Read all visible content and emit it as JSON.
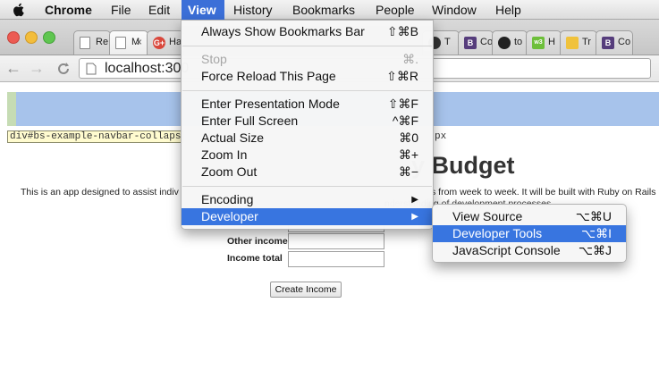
{
  "menubar": {
    "app_name": "Chrome",
    "items": [
      "File",
      "Edit",
      "View",
      "History",
      "Bookmarks",
      "People",
      "Window",
      "Help"
    ]
  },
  "tabs": [
    {
      "favicon": "document-icon",
      "title": "Re"
    },
    {
      "favicon": "document-icon",
      "title": "M",
      "close": "×"
    },
    {
      "favicon": "google-plus-icon",
      "favicon_text": "G+",
      "title": "Ha"
    },
    {
      "favicon": "github-icon",
      "title": "T"
    },
    {
      "favicon": "bootstrap-icon",
      "favicon_text": "B",
      "title": "Co"
    },
    {
      "favicon": "github-icon",
      "title": "to"
    },
    {
      "favicon": "w3c-icon",
      "favicon_text": "w3",
      "title": "H"
    },
    {
      "favicon": "bird-icon",
      "title": "Tr"
    },
    {
      "favicon": "bootstrap-icon",
      "favicon_text": "B",
      "title": "Co"
    }
  ],
  "toolbar": {
    "back": "←",
    "forward": "→",
    "url": "localhost:300"
  },
  "page": {
    "inspector_tooltip": "div#bs-example-navbar-collaps",
    "inspector_suffix": "px",
    "heading": "y Budget",
    "intro": "This is an app designed to assist indiv",
    "intro_right": "s from week to week. It will be built with Ruby on Rails",
    "intro2": "nderstanding of development processes",
    "labels": {
      "other_income": "Other income",
      "income_total": "Income total"
    },
    "submit": "Create Income"
  },
  "view_menu": {
    "items": [
      {
        "label": "Always Show Bookmarks Bar",
        "shortcut": "⇧⌘B"
      },
      {
        "label": "Stop",
        "shortcut": "⌘.",
        "disabled": true
      },
      {
        "label": "Force Reload This Page",
        "shortcut": "⇧⌘R"
      },
      {
        "label": "Enter Presentation Mode",
        "shortcut": "⇧⌘F"
      },
      {
        "label": "Enter Full Screen",
        "shortcut": "^⌘F"
      },
      {
        "label": "Actual Size",
        "shortcut": "⌘0"
      },
      {
        "label": "Zoom In",
        "shortcut": "⌘+"
      },
      {
        "label": "Zoom Out",
        "shortcut": "⌘−"
      },
      {
        "label": "Encoding",
        "shortcut": "▶"
      },
      {
        "label": "Developer",
        "shortcut": "▶"
      }
    ]
  },
  "developer_menu": {
    "items": [
      {
        "label": "View Source",
        "shortcut": "⌥⌘U"
      },
      {
        "label": "Developer Tools",
        "shortcut": "⌥⌘I"
      },
      {
        "label": "JavaScript Console",
        "shortcut": "⌥⌘J"
      }
    ]
  },
  "colors": {
    "menu_highlight": "#3875e0",
    "navbar_strip": "#a7c3eb"
  }
}
